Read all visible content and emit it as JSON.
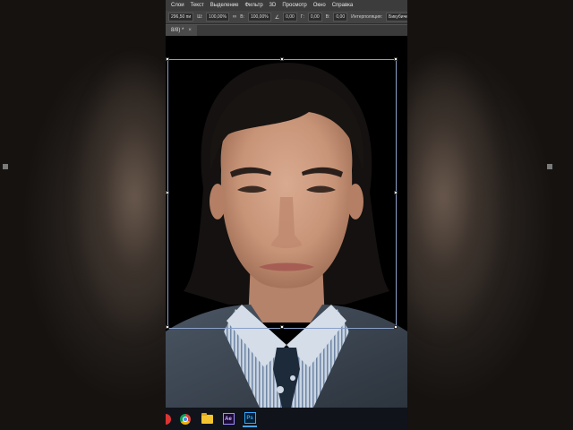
{
  "menu": {
    "items": [
      "Слои",
      "Текст",
      "Выделение",
      "Фильтр",
      "3D",
      "Просмотр",
      "Окно",
      "Справка"
    ]
  },
  "options": {
    "x_value": "296,50 пи",
    "w_value": "100,00%",
    "h_value": "100,00%",
    "angle_value": "0,00",
    "h_skew_value": "0,00",
    "v_skew_value": "0,00",
    "interpolation_label": "Интерполяция:",
    "interpolation_value": "Бикубиче"
  },
  "tab": {
    "label": "8/8) *",
    "close": "×"
  },
  "taskbar": {
    "apps": [
      "chrome-icon",
      "folder-icon",
      "after-effects-icon",
      "photoshop-icon"
    ],
    "ae_label": "Ae",
    "ps_label": "Ps"
  },
  "colors": {
    "menubar": "#3c3c3c",
    "optionsbar": "#434343",
    "transform_box": "#8aa0c8",
    "suit": "#3b4652",
    "shirt": "#b7c4d4"
  }
}
